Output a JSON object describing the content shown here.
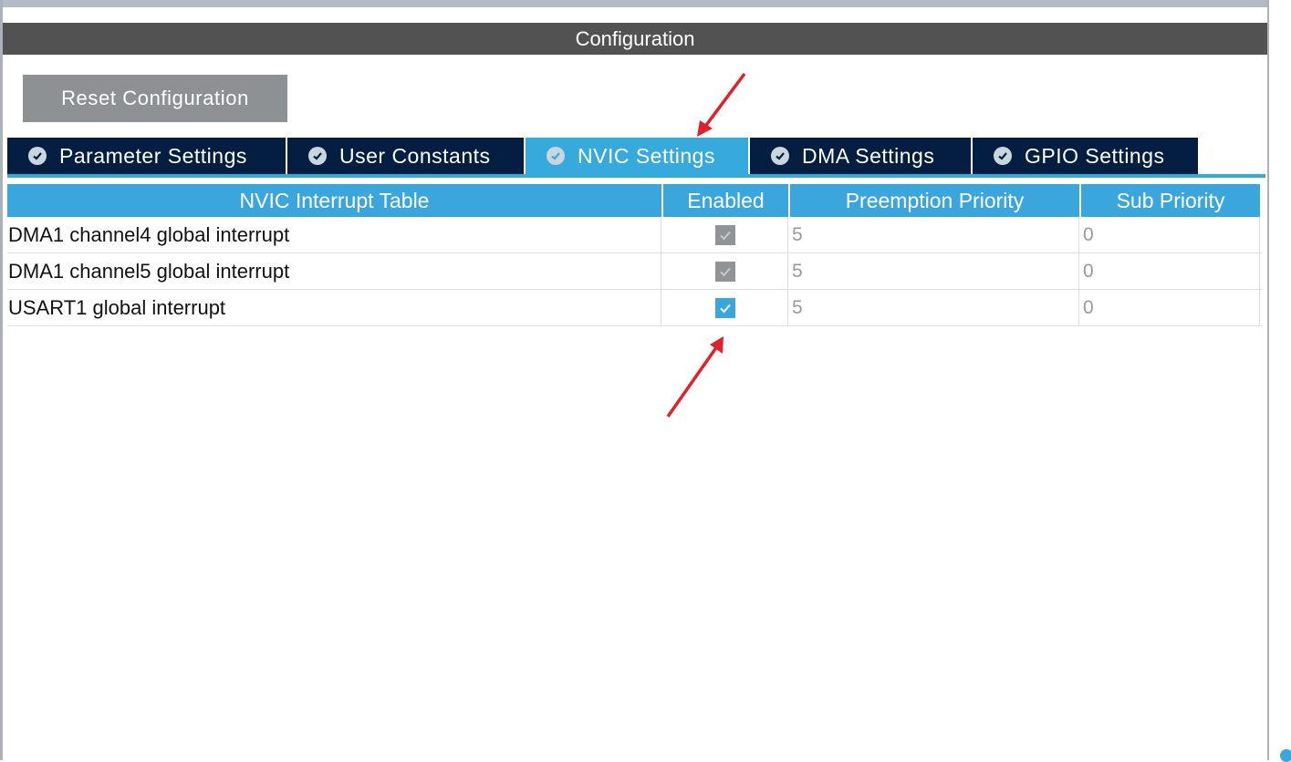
{
  "header": {
    "title": "Configuration"
  },
  "toolbar": {
    "reset_label": "Reset Configuration"
  },
  "tabs": [
    {
      "label": "Parameter Settings",
      "active": false
    },
    {
      "label": "User Constants",
      "active": false
    },
    {
      "label": "NVIC Settings",
      "active": true
    },
    {
      "label": "DMA Settings",
      "active": false
    },
    {
      "label": "GPIO Settings",
      "active": false
    }
  ],
  "table": {
    "columns": [
      "NVIC Interrupt Table",
      "Enabled",
      "Preemption Priority",
      "Sub Priority"
    ],
    "rows": [
      {
        "name": "DMA1 channel4 global interrupt",
        "enabled": true,
        "editable": false,
        "preemption": "5",
        "sub": "0"
      },
      {
        "name": "DMA1 channel5 global interrupt",
        "enabled": true,
        "editable": false,
        "preemption": "5",
        "sub": "0"
      },
      {
        "name": "USART1 global interrupt",
        "enabled": true,
        "editable": true,
        "preemption": "5",
        "sub": "0"
      }
    ]
  },
  "colors": {
    "header_bg": "#525252",
    "tab_bg": "#031e40",
    "tab_active": "#36a9dd",
    "table_header": "#3ba6dc",
    "checkbox_disabled": "#909497",
    "annotation_arrow": "#e0202a"
  }
}
